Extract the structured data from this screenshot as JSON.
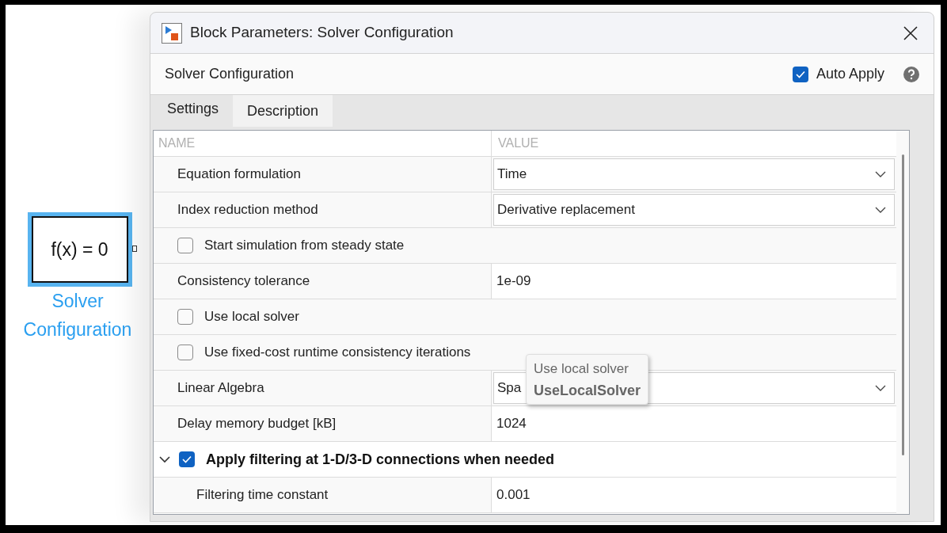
{
  "canvas_block": {
    "expression": "f(x) = 0",
    "label": "Solver Configuration",
    "selected": true
  },
  "dialog": {
    "title": "Block Parameters: Solver Configuration",
    "block_name": "Solver Configuration",
    "auto_apply": {
      "label": "Auto Apply",
      "checked": true
    },
    "tabs": [
      {
        "label": "Settings",
        "selected": true
      },
      {
        "label": "Description",
        "selected": false
      }
    ],
    "columns": [
      "NAME",
      "VALUE"
    ],
    "rows": [
      {
        "kind": "dropdown",
        "name": "Equation formulation",
        "value": "Time"
      },
      {
        "kind": "dropdown",
        "name": "Index reduction method",
        "value": "Derivative replacement"
      },
      {
        "kind": "checkbox",
        "name": "Start simulation from steady state",
        "checked": false
      },
      {
        "kind": "text",
        "name": "Consistency tolerance",
        "value": "1e-09"
      },
      {
        "kind": "checkbox",
        "name": "Use local solver",
        "checked": false
      },
      {
        "kind": "checkbox",
        "name": "Use fixed-cost runtime consistency iterations",
        "checked": false
      },
      {
        "kind": "dropdown",
        "name": "Linear Algebra",
        "value": "Spa"
      },
      {
        "kind": "text",
        "name": "Delay memory budget [kB]",
        "value": "1024"
      },
      {
        "kind": "group",
        "name": "Apply filtering at 1-D/3-D connections when needed",
        "checked": true,
        "expanded": true,
        "children": [
          {
            "kind": "text",
            "name": "Filtering time constant",
            "value": "0.001"
          }
        ]
      }
    ],
    "tooltip": {
      "title": "Use local solver",
      "param": "UseLocalSolver"
    }
  }
}
